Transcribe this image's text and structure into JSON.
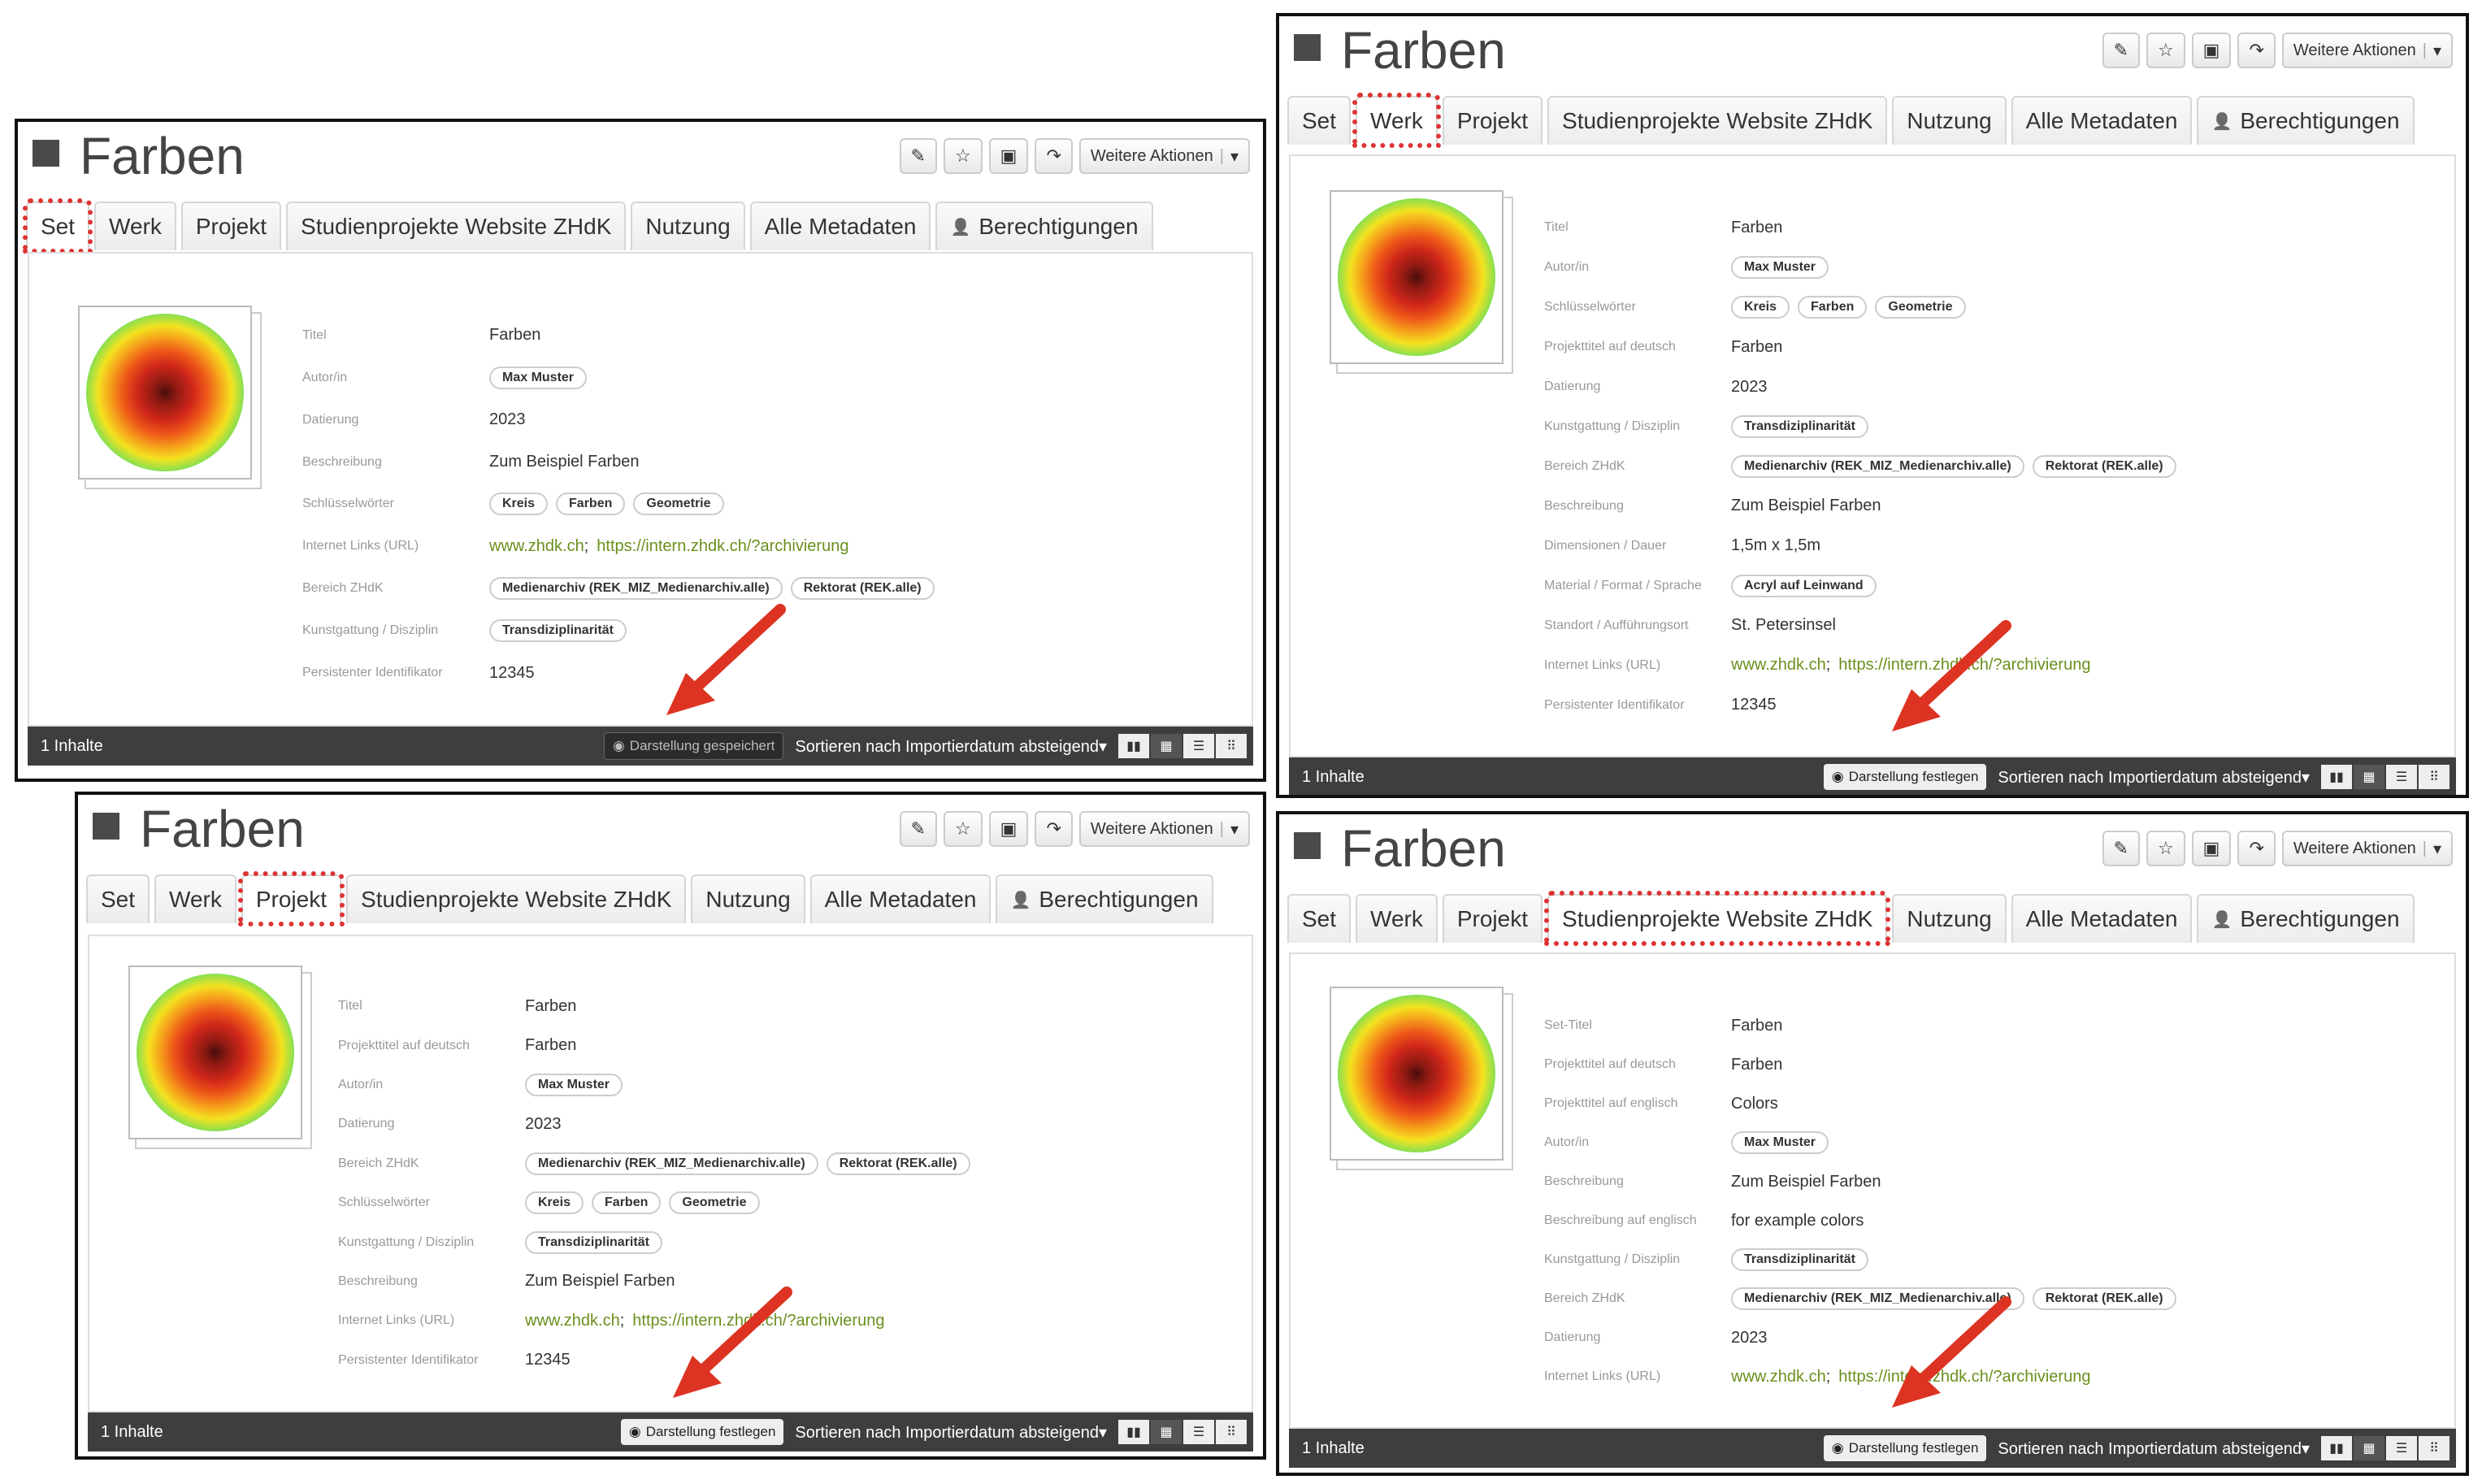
{
  "title": "Farben",
  "toolbar": {
    "icons": [
      "pencil-icon",
      "star-icon",
      "folder-icon",
      "share-icon"
    ],
    "more": "Weitere Aktionen",
    "more_sep": "|",
    "caret": "▾"
  },
  "tabs": [
    "Set",
    "Werk",
    "Projekt",
    "Studienprojekte Website ZHdK",
    "Nutzung",
    "Alle Metadaten",
    "Berechtigungen"
  ],
  "footer": {
    "count": "1 Inhalte",
    "saved": "Darstellung gespeichert",
    "set": "Darstellung festlegen",
    "sort": "Sortieren nach Importierdatum absteigend",
    "caret": "▾"
  },
  "colors": {
    "highlight": "#dd3333",
    "arrow": "#dd3322",
    "link": "#6a8f1c",
    "footer": "#3e3e3e"
  },
  "panels": {
    "set": {
      "rows": [
        {
          "label": "Titel",
          "text": "Farben"
        },
        {
          "label": "Autor/in",
          "pills": [
            "Max Muster"
          ]
        },
        {
          "label": "Datierung",
          "text": "2023"
        },
        {
          "label": "Beschreibung",
          "text": "Zum Beispiel Farben"
        },
        {
          "label": "Schlüsselwörter",
          "pills": [
            "Kreis",
            "Farben",
            "Geometrie"
          ]
        },
        {
          "label": "Internet Links (URL)",
          "links": [
            "www.zhdk.ch",
            "https://intern.zhdk.ch/?archivierung"
          ]
        },
        {
          "label": "Bereich ZHdK",
          "pills": [
            "Medienarchiv (REK_MIZ_Medienarchiv.alle)",
            "Rektorat (REK.alle)"
          ]
        },
        {
          "label": "Kunstgattung / Disziplin",
          "pills": [
            "Transdiziplinarität"
          ]
        },
        {
          "label": "Persistenter Identifikator",
          "text": "12345"
        }
      ]
    },
    "werk": {
      "rows": [
        {
          "label": "Titel",
          "text": "Farben"
        },
        {
          "label": "Autor/in",
          "pills": [
            "Max Muster"
          ]
        },
        {
          "label": "Schlüsselwörter",
          "pills": [
            "Kreis",
            "Farben",
            "Geometrie"
          ]
        },
        {
          "label": "Projekttitel auf deutsch",
          "text": "Farben"
        },
        {
          "label": "Datierung",
          "text": "2023"
        },
        {
          "label": "Kunstgattung / Disziplin",
          "pills": [
            "Transdiziplinarität"
          ]
        },
        {
          "label": "Bereich ZHdK",
          "pills": [
            "Medienarchiv (REK_MIZ_Medienarchiv.alle)",
            "Rektorat (REK.alle)"
          ]
        },
        {
          "label": "Beschreibung",
          "text": "Zum Beispiel Farben"
        },
        {
          "label": "Dimensionen / Dauer",
          "text": "1,5m x 1,5m"
        },
        {
          "label": "Material / Format / Sprache",
          "pills": [
            "Acryl auf Leinwand"
          ]
        },
        {
          "label": "Standort / Aufführungsort",
          "text": "St. Petersinsel"
        },
        {
          "label": "Internet Links (URL)",
          "links": [
            "www.zhdk.ch",
            "https://intern.zhdk.ch/?archivierung"
          ]
        },
        {
          "label": "Persistenter Identifikator",
          "text": "12345"
        }
      ]
    },
    "projekt": {
      "rows": [
        {
          "label": "Titel",
          "text": "Farben"
        },
        {
          "label": "Projekttitel auf deutsch",
          "text": "Farben"
        },
        {
          "label": "Autor/in",
          "pills": [
            "Max Muster"
          ]
        },
        {
          "label": "Datierung",
          "text": "2023"
        },
        {
          "label": "Bereich ZHdK",
          "pills": [
            "Medienarchiv (REK_MIZ_Medienarchiv.alle)",
            "Rektorat (REK.alle)"
          ]
        },
        {
          "label": "Schlüsselwörter",
          "pills": [
            "Kreis",
            "Farben",
            "Geometrie"
          ]
        },
        {
          "label": "Kunstgattung / Disziplin",
          "pills": [
            "Transdiziplinarität"
          ]
        },
        {
          "label": "Beschreibung",
          "text": "Zum Beispiel Farben"
        },
        {
          "label": "Internet Links (URL)",
          "links": [
            "www.zhdk.ch",
            "https://intern.zhdk.ch/?archivierung"
          ]
        },
        {
          "label": "Persistenter Identifikator",
          "text": "12345"
        }
      ]
    },
    "studien": {
      "rows": [
        {
          "label": "Set-Titel",
          "text": "Farben"
        },
        {
          "label": "Projekttitel auf deutsch",
          "text": "Farben"
        },
        {
          "label": "Projekttitel auf englisch",
          "text": "Colors"
        },
        {
          "label": "Autor/in",
          "pills": [
            "Max Muster"
          ]
        },
        {
          "label": "Beschreibung",
          "text": "Zum Beispiel Farben"
        },
        {
          "label": "Beschreibung auf englisch",
          "text": "for example colors"
        },
        {
          "label": "Kunstgattung / Disziplin",
          "pills": [
            "Transdiziplinarität"
          ]
        },
        {
          "label": "Bereich ZHdK",
          "pills": [
            "Medienarchiv (REK_MIZ_Medienarchiv.alle)",
            "Rektorat (REK.alle)"
          ]
        },
        {
          "label": "Datierung",
          "text": "2023"
        },
        {
          "label": "Internet Links (URL)",
          "links": [
            "www.zhdk.ch",
            "https://intern.zhdk.ch/?archivierung"
          ]
        }
      ]
    }
  }
}
